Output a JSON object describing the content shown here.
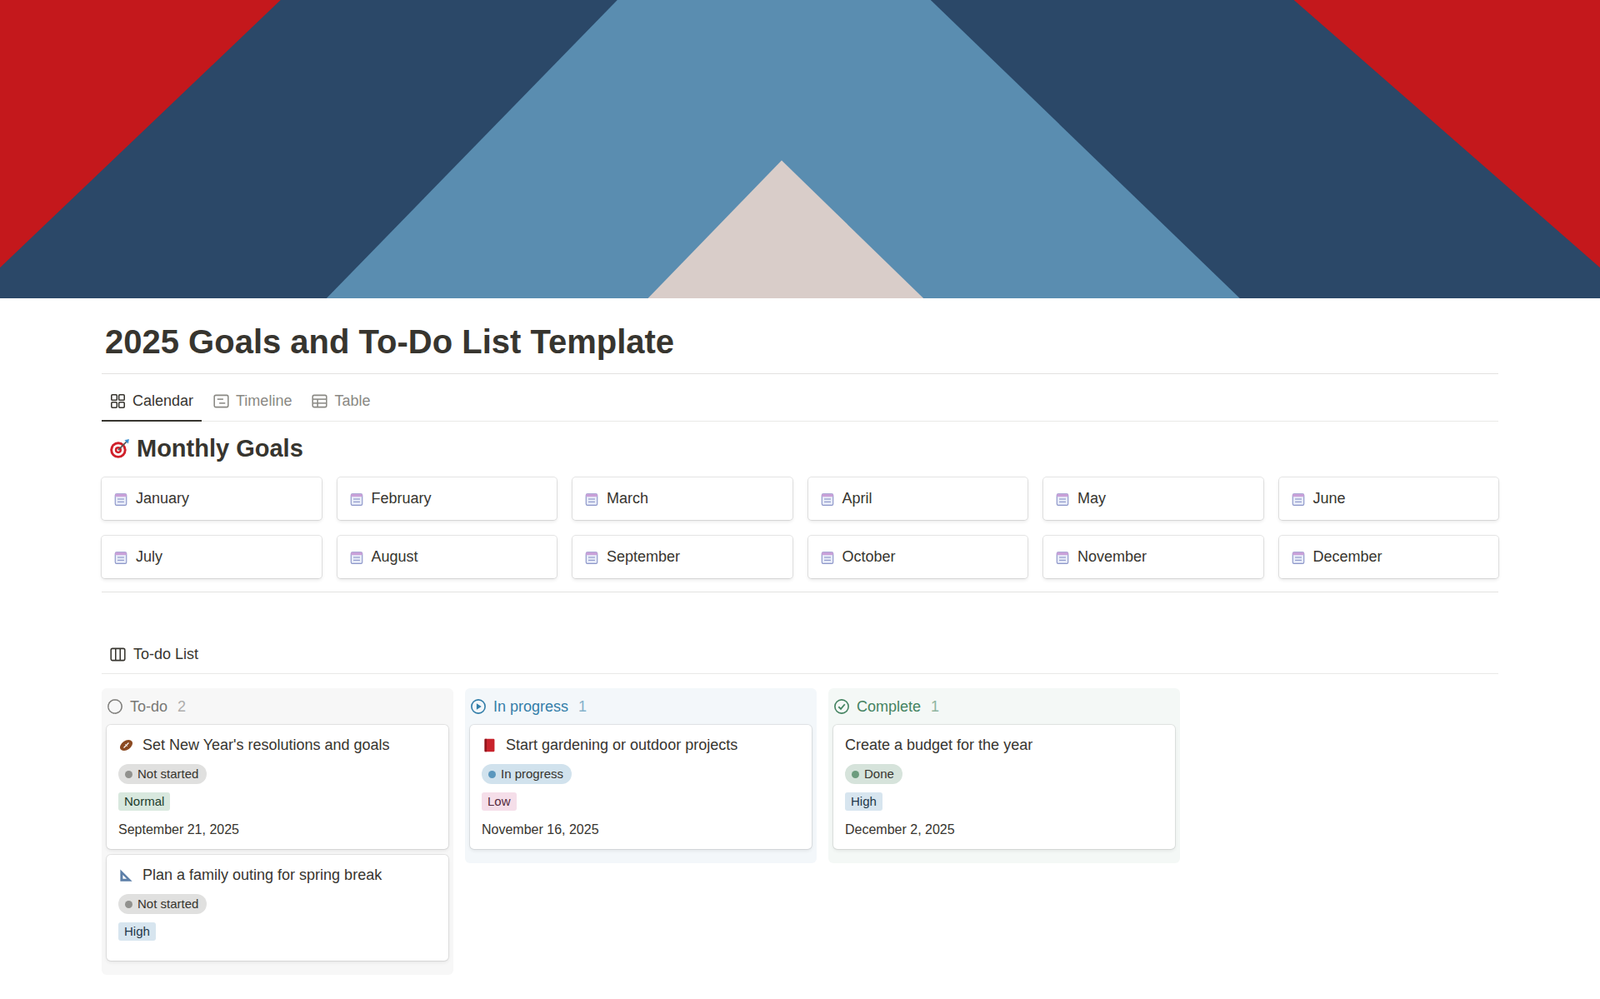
{
  "page": {
    "title": "2025 Goals and To-Do List Template"
  },
  "views": [
    {
      "label": "Calendar",
      "selected": true
    },
    {
      "label": "Timeline",
      "selected": false
    },
    {
      "label": "Table",
      "selected": false
    }
  ],
  "monthly_goals": {
    "heading": "Monthly Goals",
    "months": [
      "January",
      "February",
      "March",
      "April",
      "May",
      "June",
      "July",
      "August",
      "September",
      "October",
      "November",
      "December"
    ]
  },
  "board": {
    "title": "To-do List",
    "columns": [
      {
        "name": "To-do",
        "count": "2",
        "kind": "todo",
        "color": "#787774",
        "cards": [
          {
            "kind": "football",
            "title": "Set New Year's resolutions and goals",
            "status": {
              "label": "Not started",
              "color": "#91918e"
            },
            "priority": {
              "label": "Normal",
              "color": "#4f9768"
            },
            "date": "September 21, 2025"
          },
          {
            "kind": "ruler",
            "title": "Plan a family outing for spring break",
            "status": {
              "label": "Not started",
              "color": "#91918e"
            },
            "priority": {
              "label": "High",
              "color": "#4a8ab8"
            },
            "date": ""
          }
        ]
      },
      {
        "name": "In progress",
        "count": "1",
        "kind": "progress",
        "color": "#337ea9",
        "cards": [
          {
            "kind": "book",
            "title": "Start gardening or outdoor projects",
            "status": {
              "label": "In progress",
              "color": "#5b97bd"
            },
            "priority": {
              "label": "Low",
              "color": "#d16a9a"
            },
            "date": "November 16, 2025"
          }
        ]
      },
      {
        "name": "Complete",
        "count": "1",
        "kind": "done",
        "color": "#448361",
        "cards": [
          {
            "kind": "plain",
            "title": "Create a budget for the year",
            "status": {
              "label": "Done",
              "color": "#6c9b7d"
            },
            "priority": {
              "label": "High",
              "color": "#4a8ab8"
            },
            "date": "December 2, 2025"
          }
        ]
      }
    ]
  }
}
